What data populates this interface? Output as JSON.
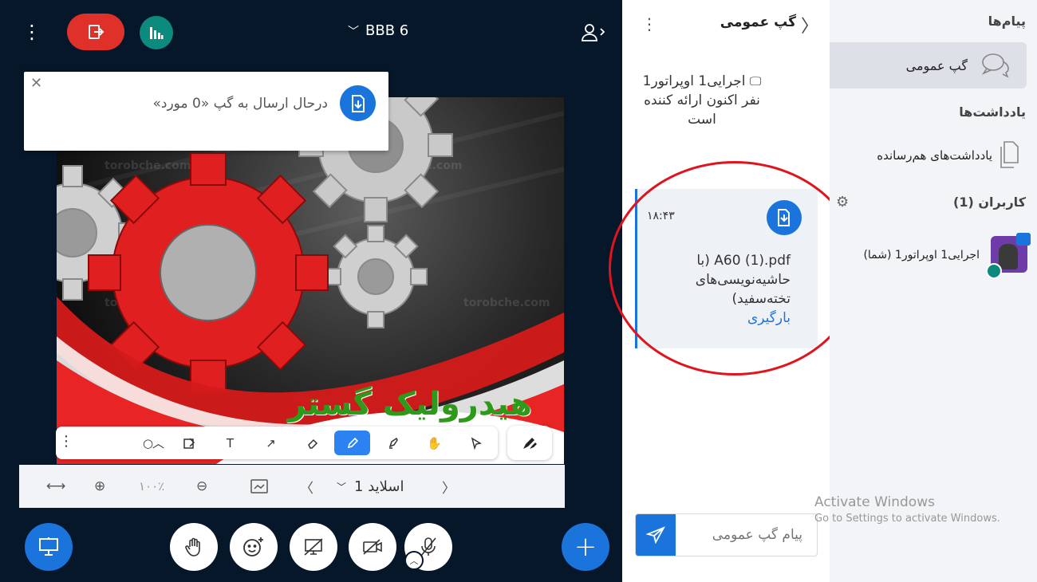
{
  "header": {
    "meeting_title": "BBB 6"
  },
  "toast": {
    "message": "درحال ارسال به گپ «0 مورد»"
  },
  "slide": {
    "heading": "هیدرولیک گستر",
    "watermark": "torobche.com"
  },
  "slide_controls": {
    "zoom_value": "۱۰۰٪",
    "slide_label": "اسلاید 1"
  },
  "chat": {
    "title": "گپ عمومی",
    "system_message": "اجرایی1 اوپراتور1 نفر اکنون ارائه کننده است",
    "file_message": {
      "time": "۱۸:۴۳",
      "file_name": "A60 (1).pdf (با حاشیه‌نویسی‌های تخته‌سفید)",
      "download_label": "بارگیری"
    },
    "input_placeholder": "پیام گپ عمومی"
  },
  "sidebar": {
    "messages_heading": "پیام‌ها",
    "public_chat_label": "گپ عمومی",
    "notes_heading": "یادداشت‌ها",
    "shared_notes_label": "یادداشت‌های هم‌رسانده",
    "users_heading": "کاربران (1)",
    "user_name": "اجرایی1 اوپراتور1 (شما)"
  },
  "os_overlay": {
    "title": "Activate Windows",
    "subtitle": "Go to Settings to activate Windows."
  },
  "colors": {
    "primary": "#1b74dc",
    "leave": "#e0302a",
    "stats": "#0d8a7e",
    "highlight": "#e0141e",
    "background": "#06172a"
  }
}
